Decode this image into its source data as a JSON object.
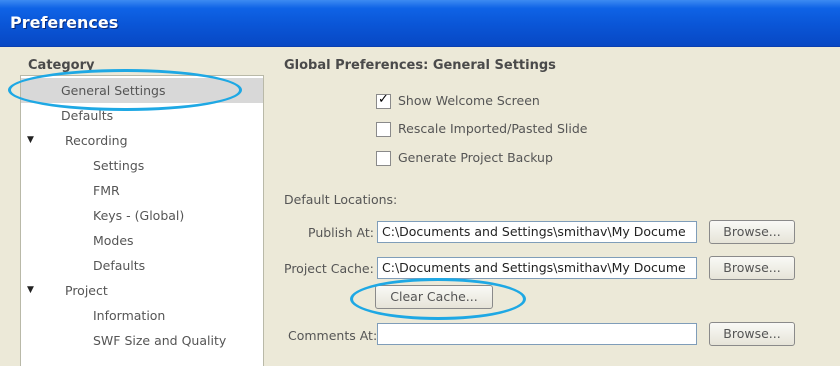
{
  "window": {
    "title": "Preferences"
  },
  "sidebar": {
    "heading": "Category",
    "items": [
      {
        "label": "General Settings"
      },
      {
        "label": "Defaults"
      },
      {
        "label": "Recording",
        "arrow": "▼"
      },
      {
        "label": "Settings"
      },
      {
        "label": "FMR"
      },
      {
        "label": "Keys - (Global)"
      },
      {
        "label": "Modes"
      },
      {
        "label": "Defaults"
      },
      {
        "label": "Project",
        "arrow": "▼"
      },
      {
        "label": "Information"
      },
      {
        "label": "SWF Size and Quality"
      }
    ]
  },
  "main": {
    "title": "Global Preferences: General Settings",
    "options": [
      {
        "label": "Show Welcome Screen",
        "checked": true,
        "mark": "✓"
      },
      {
        "label": "Rescale Imported/Pasted Slide",
        "checked": false
      },
      {
        "label": "Generate Project Backup",
        "checked": false
      }
    ],
    "locations_label": "Default Locations:",
    "publish": {
      "label": "Publish At:",
      "value": "C:\\Documents and Settings\\smithav\\My Docume",
      "button": "Browse..."
    },
    "cache": {
      "label": "Project Cache:",
      "value": "C:\\Documents and Settings\\smithav\\My Docume",
      "button": "Browse...",
      "clear_button": "Clear Cache..."
    },
    "comments": {
      "label": "Comments At:",
      "value": "",
      "button": "Browse..."
    }
  },
  "colors": {
    "highlight_oval": "#1ea8e4",
    "titlebar": "#0a55d6"
  }
}
